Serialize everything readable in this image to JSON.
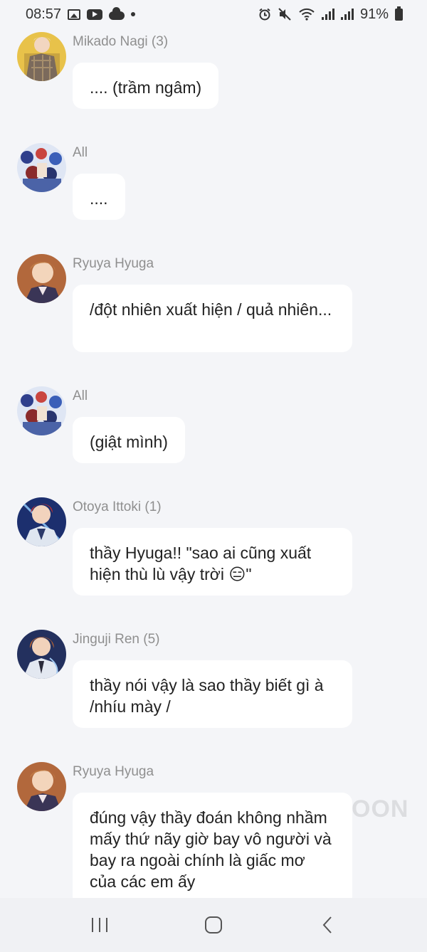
{
  "status_bar": {
    "time": "08:57",
    "battery": "91%"
  },
  "messages": [
    {
      "sender": "Mikado Nagi (3)",
      "text": ".... (trầm ngâm)",
      "avatar": "avatar-mikado-nagi"
    },
    {
      "sender": "All",
      "text": "....",
      "avatar": "avatar-all"
    },
    {
      "sender": "Ryuya Hyuga",
      "text": "/đột nhiên xuất hiện / quả nhiên...",
      "avatar": "avatar-ryuya-hyuga"
    },
    {
      "sender": "All",
      "text": "(giật mình)",
      "avatar": "avatar-all"
    },
    {
      "sender": "Otoya Ittoki (1)",
      "text": "thầy Hyuga!! \"sao ai cũng xuất hiện thù lù vậy trời 😑\"",
      "avatar": "avatar-otoya-ittoki"
    },
    {
      "sender": "Jinguji Ren (5)",
      "text": "thầy nói vậy là sao thầy biết gì à /nhíu mày /",
      "avatar": "avatar-jinguji-ren"
    },
    {
      "sender": "Ryuya Hyuga",
      "text": "đúng vậy thầy đoán không nhầm mấy thứ nãy giờ bay vô người và bay ra ngoài chính là giấc mơ của các em ấy",
      "avatar": "avatar-ryuya-hyuga"
    }
  ],
  "watermark": "OON",
  "nav": {
    "recents_icon": "recent-apps-icon",
    "home_icon": "home-icon",
    "back_icon": "back-icon"
  },
  "colors": {
    "background": "#f4f5f8",
    "bubble": "#ffffff",
    "sender_text": "#8f8f8f"
  }
}
